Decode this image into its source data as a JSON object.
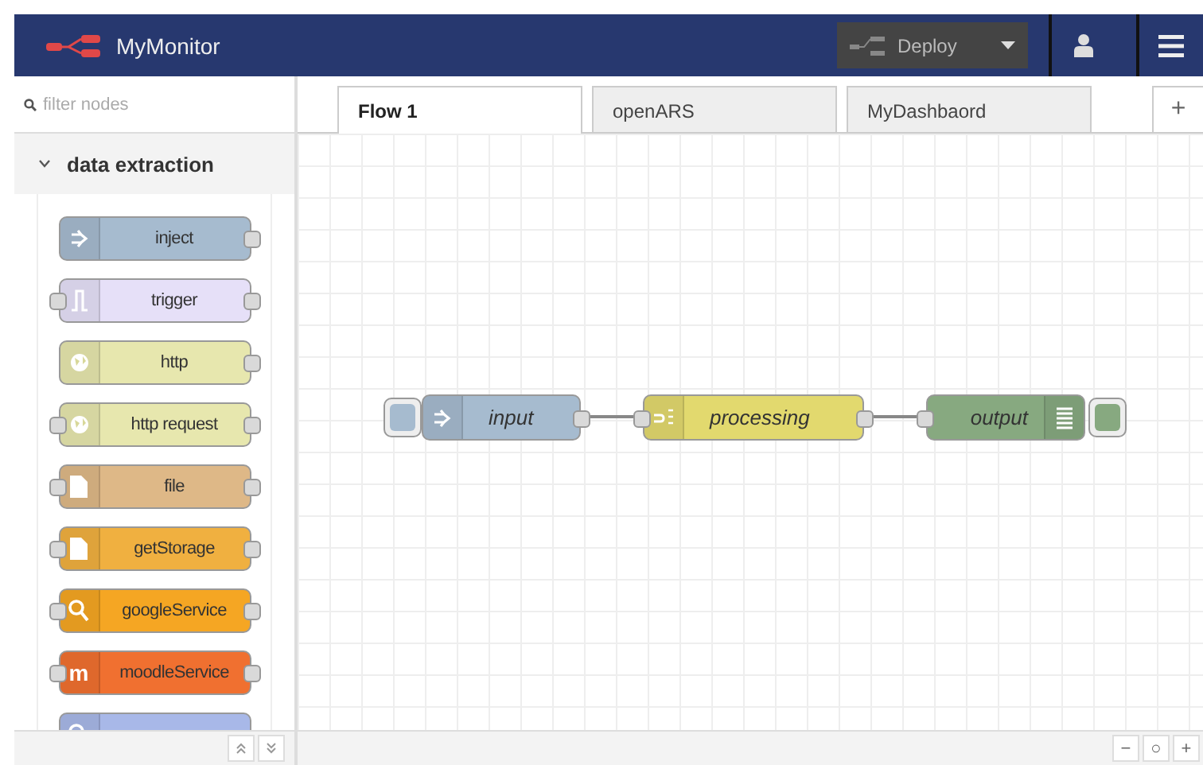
{
  "header": {
    "title": "MyMonitor",
    "deploy": "Deploy"
  },
  "sidebar": {
    "filter_placeholder": "filter nodes",
    "category": {
      "label": "data extraction",
      "expanded": true
    },
    "nodes": [
      {
        "label": "inject",
        "color": "#a6bbcf",
        "kind": "arrow",
        "input": false,
        "output": true
      },
      {
        "label": "trigger",
        "color": "#e6e0f8",
        "kind": "pulse",
        "input": true,
        "output": true
      },
      {
        "label": "http",
        "color": "#e7e7ae",
        "kind": "globe",
        "input": false,
        "output": true
      },
      {
        "label": "http request",
        "color": "#e7e7ae",
        "kind": "globe",
        "input": true,
        "output": true
      },
      {
        "label": "file",
        "color": "#deb887",
        "kind": "file",
        "input": true,
        "output": true
      },
      {
        "label": "getStorage",
        "color": "#f0b040",
        "kind": "file",
        "input": true,
        "output": true
      },
      {
        "label": "googleService",
        "color": "#f5a623",
        "kind": "search",
        "input": true,
        "output": true
      },
      {
        "label": "moodleService",
        "color": "#f07030",
        "kind": "glyph",
        "glyph": "m",
        "input": true,
        "output": true
      },
      {
        "color": "#a8b8e8",
        "kind": "search",
        "input": false,
        "output": false
      }
    ]
  },
  "tabs": [
    {
      "label": "Flow 1",
      "selected": true
    },
    {
      "label": "openARS",
      "selected": false
    },
    {
      "label": "MyDashbaord",
      "selected": false
    }
  ],
  "add_tab": "+",
  "flow": {
    "nodes": [
      {
        "label": "input",
        "color": "#a6bbcf",
        "kind": "arrow",
        "input": false,
        "output": true
      },
      {
        "label": "processing",
        "color": "#e2d96e",
        "kind": "function",
        "input": true,
        "output": true
      },
      {
        "label": "output",
        "color": "#87a980",
        "kind": "list",
        "input": true,
        "output": false
      }
    ]
  },
  "zoom": {
    "out": "−",
    "reset": "○",
    "in": "+"
  }
}
